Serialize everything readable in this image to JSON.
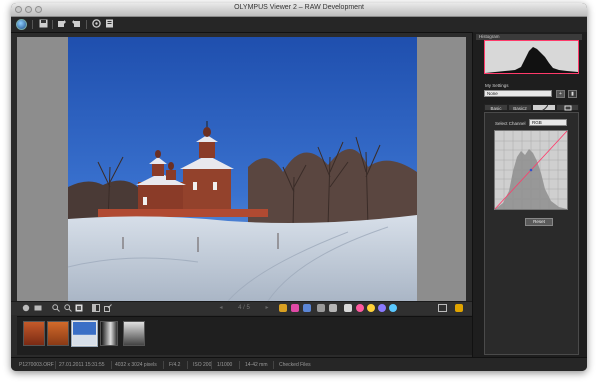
{
  "window": {
    "title": "OLYMPUS Viewer 2 – RAW Development"
  },
  "viewer": {
    "page_indicator": "4 / 5"
  },
  "right_panel": {
    "histogram_header": "Histogram",
    "my_settings_label": "My Settings",
    "my_settings_value": "None",
    "tabs": [
      {
        "label": "Basic"
      },
      {
        "label": "Basic2"
      },
      {
        "label": ""
      },
      {
        "label": ""
      }
    ],
    "select_channel_label": "Select Channel",
    "channel_value": "RGB",
    "reset_label": "Reset"
  },
  "status_bar": {
    "filename": "P1270003.ORF",
    "datetime": "27.01.2011 15:31:55",
    "dimensions": "4032 x 3024 pixels",
    "aperture": "F/4.2",
    "iso": "ISO 200",
    "exposure": "1/1000",
    "focal": "14-42 mm",
    "mode": "Checked Files"
  },
  "colors": {
    "accent": "#ff3a6a",
    "sky": "#2a5fbd",
    "window_bg": "#2b2b2b"
  },
  "icons": [
    "olympus-logo-icon",
    "save-icon",
    "rotate-left-icon",
    "rotate-right-icon",
    "settings-icon",
    "info-icon",
    "zoom-in-icon",
    "zoom-out-icon",
    "fit-icon",
    "compare-icon",
    "prev-icon",
    "next-icon",
    "reset-icon"
  ]
}
